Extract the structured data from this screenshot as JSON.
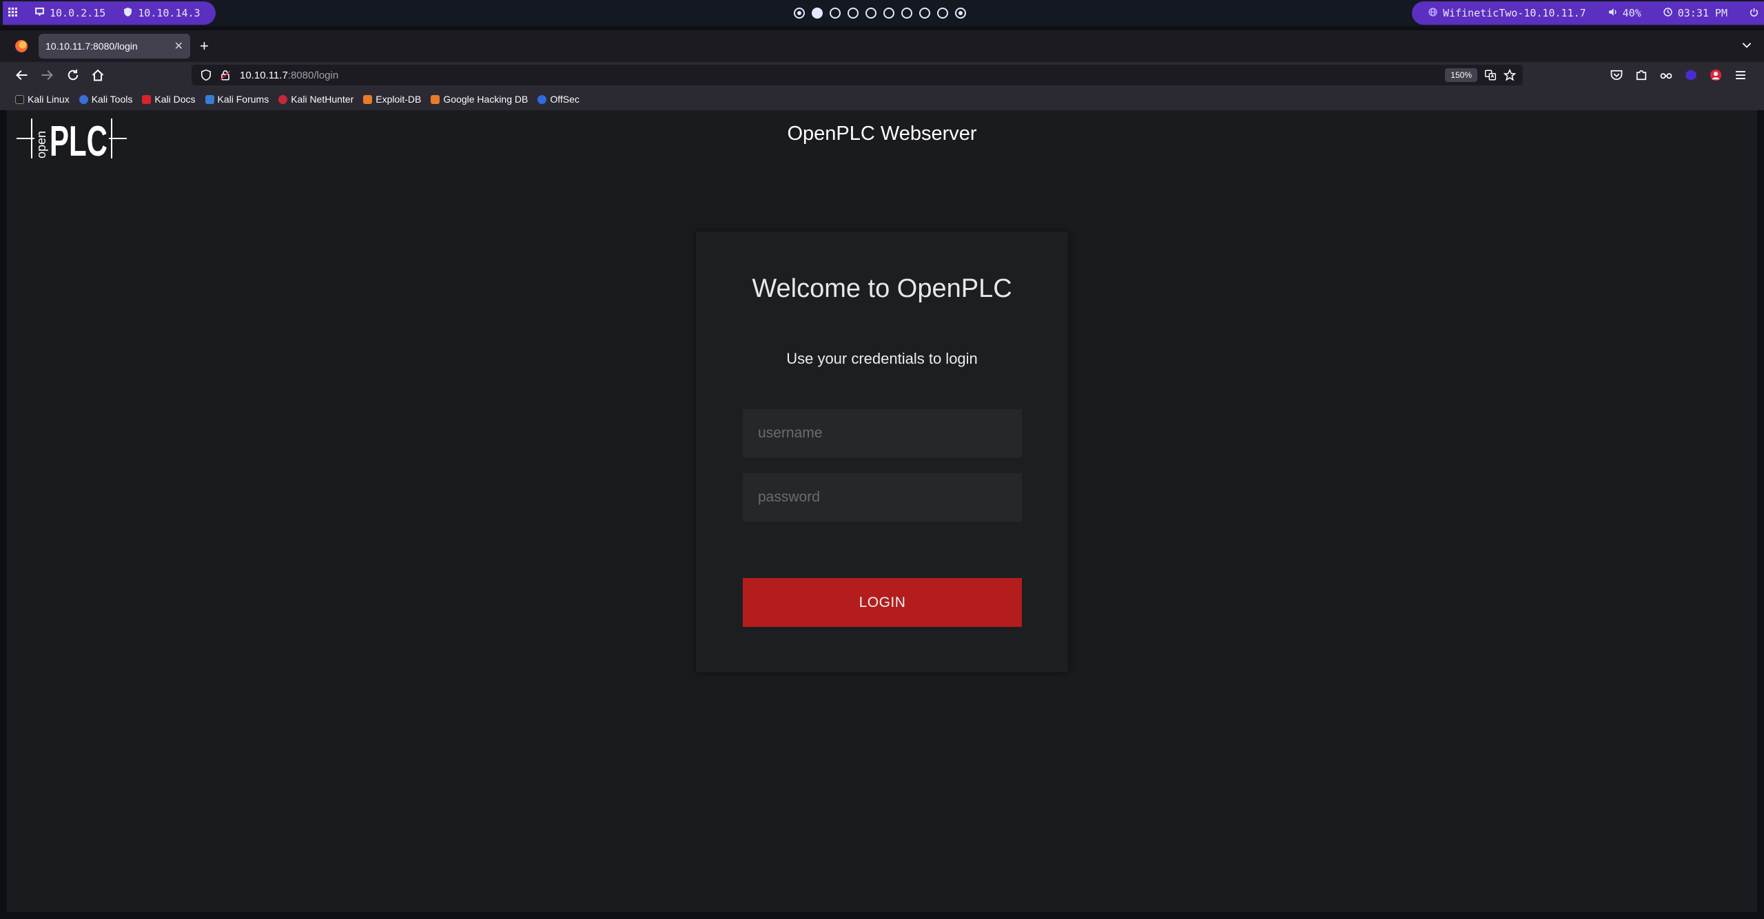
{
  "system_bar": {
    "ip_local": "10.0.2.15",
    "ip_vpn": "10.10.14.3",
    "wifi": "WifineticTwo-10.10.11.7",
    "volume": "40%",
    "clock": "03:31 PM"
  },
  "browser": {
    "tab_title": "10.10.11.7:8080/login",
    "url_host": "10.10.11.7",
    "url_rest": ":8080/login",
    "zoom": "150%",
    "bookmarks": [
      "Kali Linux",
      "Kali Tools",
      "Kali Docs",
      "Kali Forums",
      "Kali NetHunter",
      "Exploit-DB",
      "Google Hacking DB",
      "OffSec"
    ]
  },
  "page": {
    "header_title": "OpenPLC Webserver",
    "logo_text": {
      "small": "open",
      "big": "PLC"
    },
    "welcome": "Welcome to OpenPLC",
    "subtitle": "Use your credentials to login",
    "username_placeholder": "username",
    "password_placeholder": "password",
    "login_button": "LOGIN"
  },
  "colors": {
    "accent_purple": "#5b2fbf",
    "login_red": "#b41d1d",
    "page_bg": "#1a1b1e"
  }
}
